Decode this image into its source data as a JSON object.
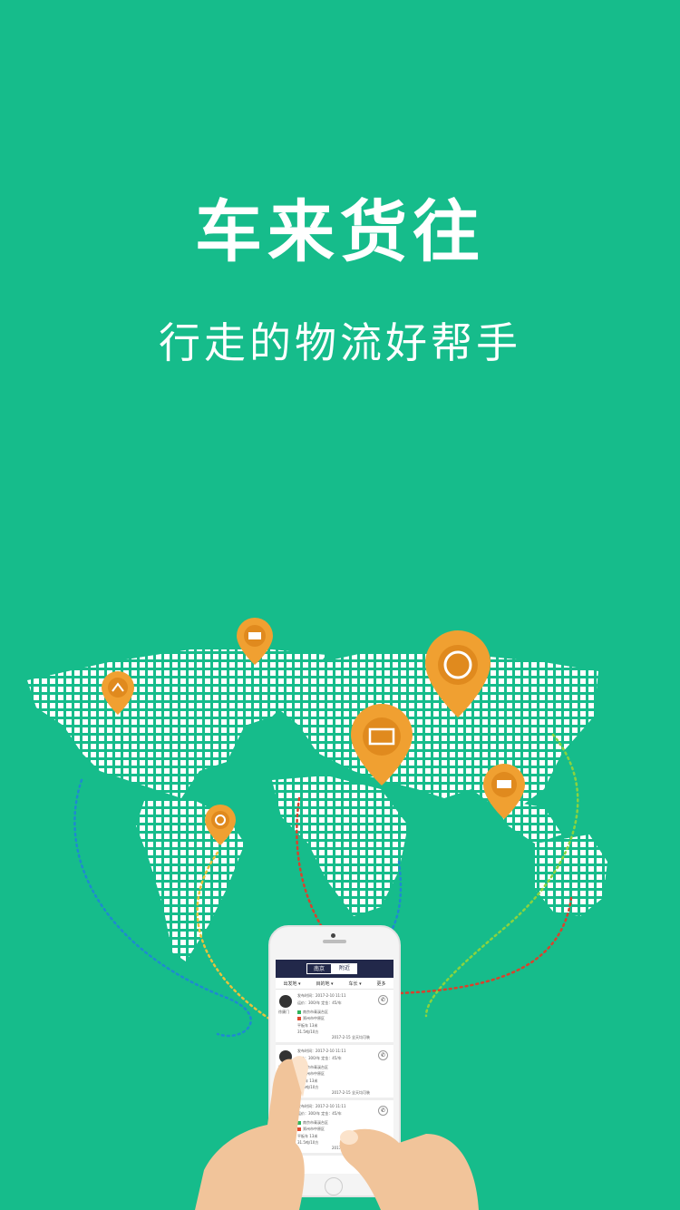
{
  "splash": {
    "title": "车来货往",
    "subtitle": "行走的物流好帮手"
  },
  "colors": {
    "background": "#16bc8b",
    "pin": "#f0a031",
    "pin_inner": "#e08a1e",
    "map_dots": "#ffffff",
    "route_green": "#8bd33e",
    "route_red": "#d9412c",
    "route_blue": "#1e8ad0",
    "route_yellow": "#e9c23b",
    "app_header": "#22284a"
  },
  "map_pins": [
    {
      "name": "truck-cash-icon"
    },
    {
      "name": "route-icon"
    },
    {
      "name": "globe-pins-icon"
    },
    {
      "name": "map-location-icon"
    },
    {
      "name": "delivery-truck-icon"
    },
    {
      "name": "headset-icon"
    }
  ],
  "phone_app": {
    "tabs": [
      "南京",
      "附近"
    ],
    "filters": [
      "出发地 ▾",
      "目的地 ▾",
      "车长 ▾",
      "更多"
    ],
    "cards": [
      {
        "user": "徐康门",
        "time": "发布时间：2017-2-10 11:11",
        "price": "运价：300/车  定金：45/车",
        "from": "南京市青溪台区",
        "to": "郑州市中原区",
        "truck": "平板车  13米",
        "weight": "31.5吨/10方",
        "date": "2017-2-15  全天均可装"
      },
      {
        "user": "徐康门",
        "time": "发布时间：2017-2-10 11:11",
        "price": "运价：300/车  定金：45/车",
        "from": "南京市青溪台区",
        "to": "郑州市中原区",
        "truck": "平板车  13米",
        "weight": "31.5吨/10方",
        "date": "2017-2-15  全天均可装"
      },
      {
        "user": "徐康门",
        "time": "发布时间：2017-2-10 11:11",
        "price": "运价：300/车  定金：45/车",
        "from": "南京市青溪台区",
        "to": "郑州市中原区",
        "truck": "平板车  13米",
        "weight": "31.5吨/10方",
        "date": "2017-2-15  全天均可装"
      }
    ]
  }
}
